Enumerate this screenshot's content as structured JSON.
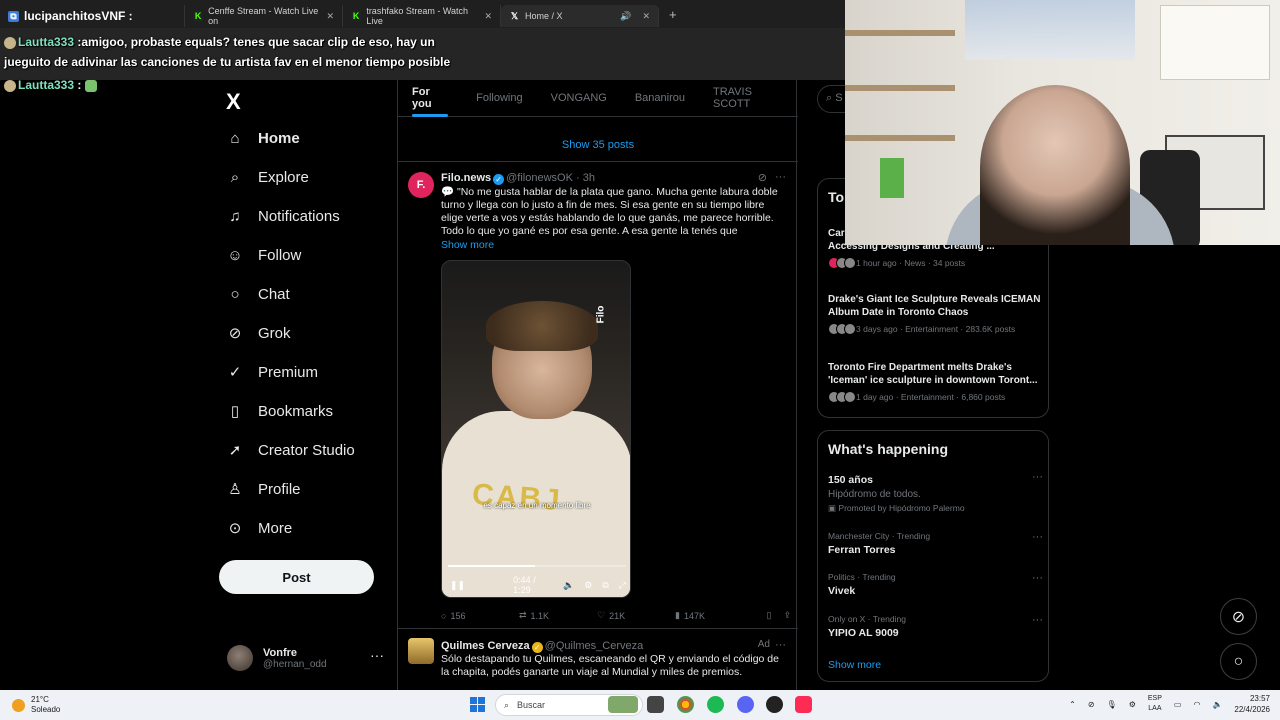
{
  "browser": {
    "tabs": [
      {
        "label": "lucipanchitosVNF :",
        "favicon": "twitch",
        "active": false
      },
      {
        "label": "Cenffe Stream - Watch Live on",
        "favicon": "kick",
        "active": false
      },
      {
        "label": "trashfako Stream - Watch Live",
        "favicon": "kick",
        "active": false
      },
      {
        "label": "Home / X",
        "favicon": "x",
        "active": true
      }
    ],
    "new_tab": "+"
  },
  "chat": {
    "line1_user": "Lautta333",
    "line1_text": ":amigoo, probaste equals? tenes que sacar clip de eso, hay un",
    "line2_text": "jueguito de adivinar las canciones de tu artista fav en el menor tiempo posible",
    "line3_user": "Lautta333",
    "line3_sep": ":"
  },
  "nav": {
    "logo": "X",
    "items": [
      {
        "label": "Home",
        "icon": "home-icon",
        "glyph": "⌂"
      },
      {
        "label": "Explore",
        "icon": "search-icon",
        "glyph": "⌕"
      },
      {
        "label": "Notifications",
        "icon": "bell-icon",
        "glyph": "🔔"
      },
      {
        "label": "Follow",
        "icon": "follow-icon",
        "glyph": "👤"
      },
      {
        "label": "Chat",
        "icon": "chat-icon",
        "glyph": "💬"
      },
      {
        "label": "Grok",
        "icon": "grok-icon",
        "glyph": "⊘"
      },
      {
        "label": "Premium",
        "icon": "premium-icon",
        "glyph": "✓"
      },
      {
        "label": "Bookmarks",
        "icon": "bookmark-icon",
        "glyph": "▯"
      },
      {
        "label": "Creator Studio",
        "icon": "rocket-icon",
        "glyph": "🚀"
      },
      {
        "label": "Profile",
        "icon": "person-icon",
        "glyph": "👤"
      },
      {
        "label": "More",
        "icon": "more-circle-icon",
        "glyph": "⋯"
      }
    ],
    "post_label": "Post",
    "profile": {
      "name": "Vonfre",
      "handle": "@hernan_odd"
    }
  },
  "feed": {
    "tabs": [
      "For you",
      "Following",
      "VONGANG",
      "Bananirou",
      "TRAVIS SCOTT"
    ],
    "active_tab": "For you",
    "show_posts": "Show 35 posts",
    "tweet1": {
      "avatar": "F.",
      "name": "Filo.news",
      "handle": "@filonewsOK",
      "time": "· 3h",
      "text": "💬 \"No me gusta hablar de la plata que gano. Mucha gente labura doble turno y llega con lo justo a fin de mes. Si esa gente en su tiempo libre elige verte a vos y estás hablando de lo que ganás, me parece horrible. Todo lo que yo gané es por esa gente. A esa gente la tenés que",
      "show_more": "Show more",
      "video": {
        "tag": "Filo",
        "caption": "es capaz en un momento libre",
        "time": "0:44 / 1:29",
        "progress": 0.49
      },
      "stats": {
        "replies": "156",
        "reposts": "1.1K",
        "likes": "21K",
        "views": "147K"
      }
    },
    "tweet2": {
      "name": "Quilmes Cerveza",
      "handle": "@Quilmes_Cerveza",
      "ad": "Ad",
      "text": "Sólo destapando tu Quilmes, escaneando el QR y enviando el código de la chapita, podés ganarte un viaje al Mundial y miles de premios."
    }
  },
  "right": {
    "search_placeholder": "S",
    "trending_head": "To",
    "news": [
      {
        "title": "Accessing Designs and Creating ...",
        "meta": "1 hour ago · News · 34 posts"
      },
      {
        "title": "Drake's Giant Ice Sculpture Reveals ICEMAN Album Date in Toronto Chaos",
        "meta": "3 days ago · Entertainment · 283.6K posts"
      },
      {
        "title": "Toronto Fire Department melts Drake's 'Iceman' ice sculpture in downtown Toront...",
        "meta": "1 day ago · Entertainment · 6,860 posts"
      }
    ],
    "news_cut": "Car",
    "whats_happening": "What's happening",
    "trends": [
      {
        "context": "",
        "name": "150 años",
        "sub": "Hipódromo de todos.",
        "promo": "Promoted by Hipódromo Palermo"
      },
      {
        "context": "Manchester City · Trending",
        "name": "Ferran Torres"
      },
      {
        "context": "Politics · Trending",
        "name": "Vivek"
      },
      {
        "context": "Only on X · Trending",
        "name": "YIPIO AL 9009"
      }
    ],
    "show_more": "Show more"
  },
  "taskbar": {
    "temp": "21°C",
    "weather": "Soleado",
    "search": "Buscar",
    "lang1": "ESP",
    "lang2": "LAA",
    "time": "23:57",
    "date": "22/4/2026"
  }
}
